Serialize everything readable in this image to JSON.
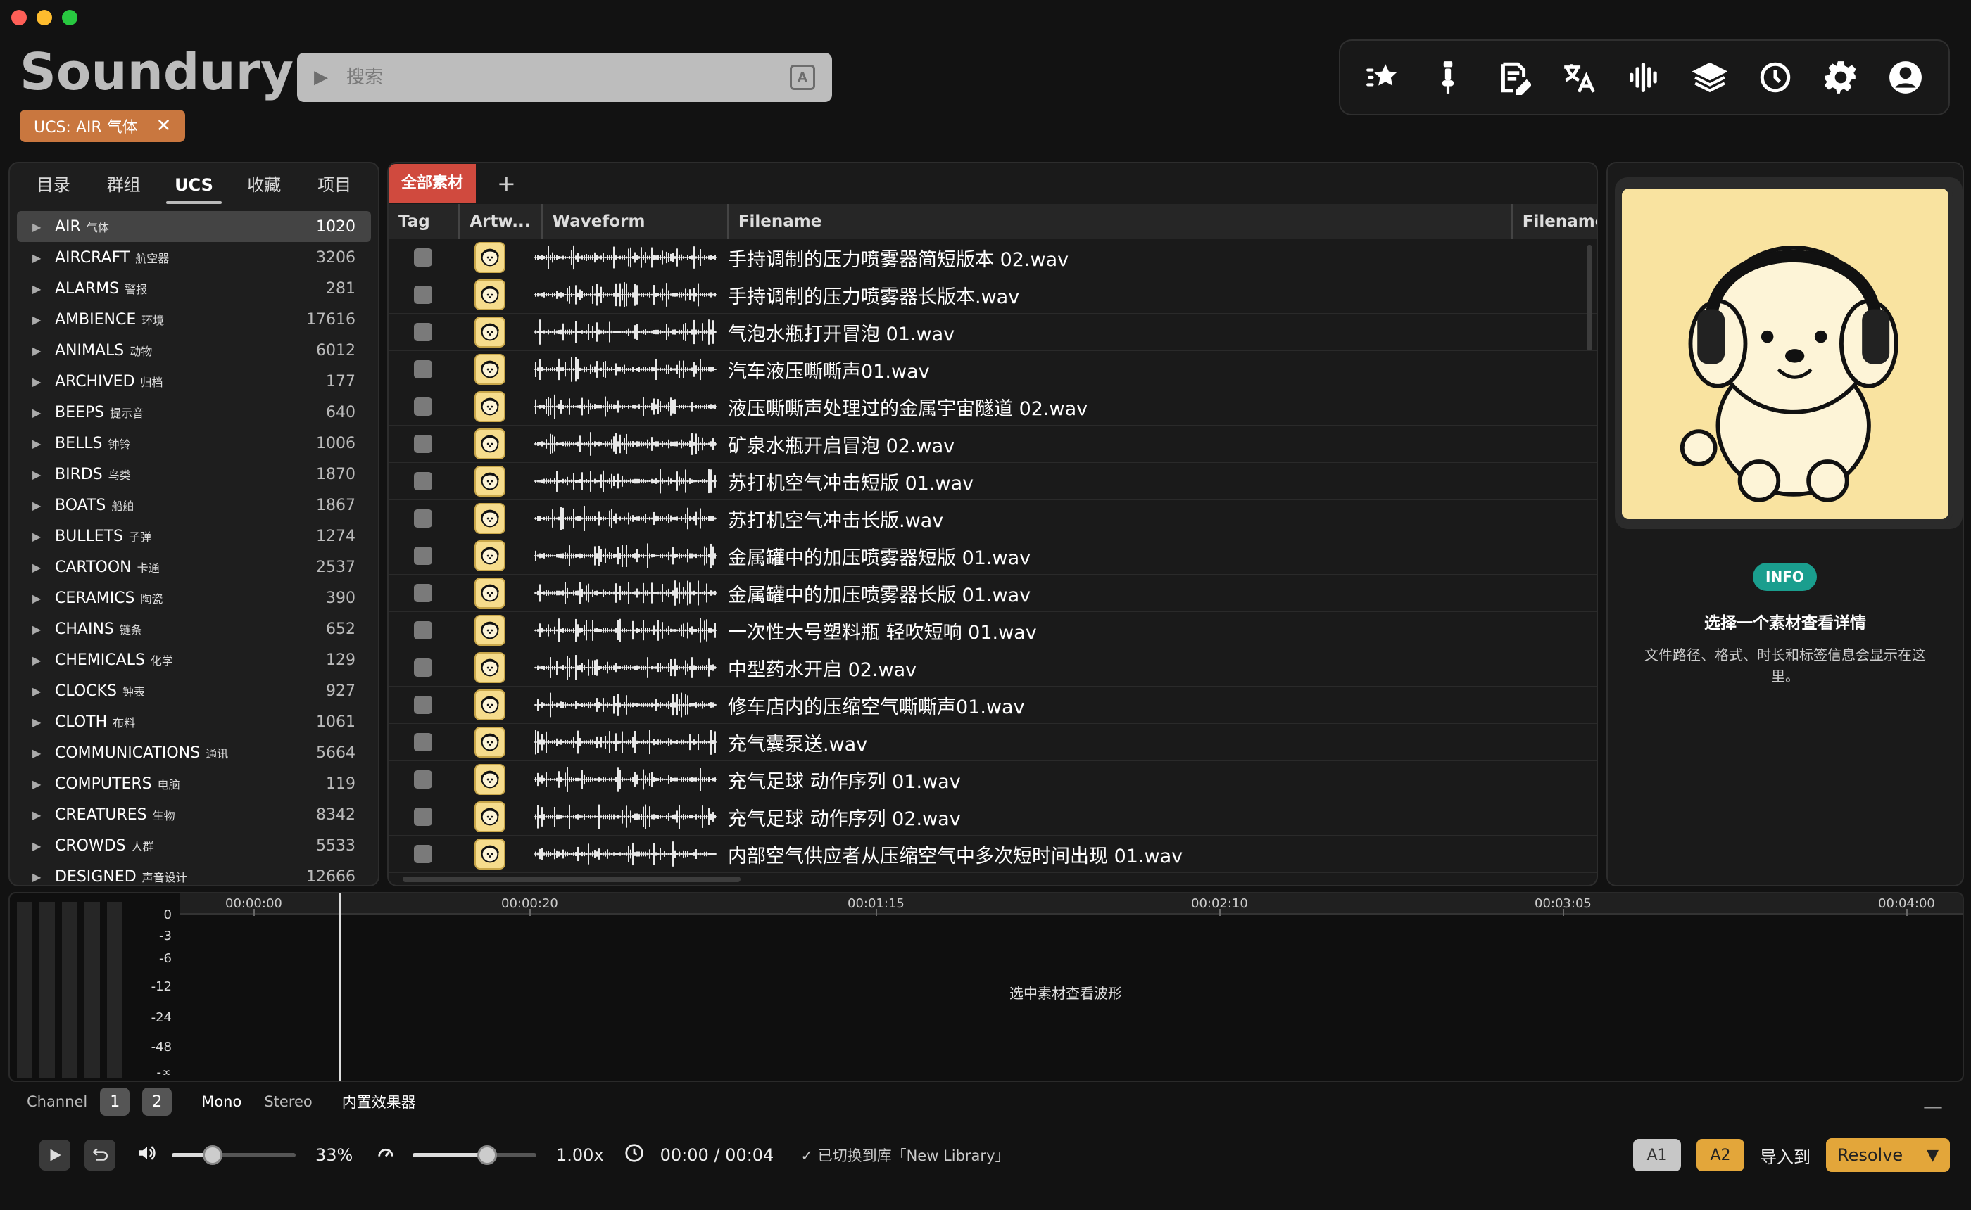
{
  "app": {
    "title": "Soundury",
    "search_placeholder": "搜索",
    "filter_chip": "UCS: AIR 气体"
  },
  "toolbar": {
    "icons": [
      "star-sparkle-icon",
      "microphone-icon",
      "edit-document-icon",
      "translate-icon",
      "waveform-icon",
      "layers-icon",
      "history-icon",
      "gear-icon",
      "user-icon"
    ]
  },
  "left_panel": {
    "tabs": [
      "目录",
      "群组",
      "UCS",
      "收藏",
      "项目"
    ],
    "active_tab": "UCS",
    "categories": [
      {
        "name": "AIR",
        "zh": "气体",
        "count": "1020"
      },
      {
        "name": "AIRCRAFT",
        "zh": "航空器",
        "count": "3206"
      },
      {
        "name": "ALARMS",
        "zh": "警报",
        "count": "281"
      },
      {
        "name": "AMBIENCE",
        "zh": "环境",
        "count": "17616"
      },
      {
        "name": "ANIMALS",
        "zh": "动物",
        "count": "6012"
      },
      {
        "name": "ARCHIVED",
        "zh": "归档",
        "count": "177"
      },
      {
        "name": "BEEPS",
        "zh": "提示音",
        "count": "640"
      },
      {
        "name": "BELLS",
        "zh": "钟铃",
        "count": "1006"
      },
      {
        "name": "BIRDS",
        "zh": "鸟类",
        "count": "1870"
      },
      {
        "name": "BOATS",
        "zh": "船舶",
        "count": "1867"
      },
      {
        "name": "BULLETS",
        "zh": "子弹",
        "count": "1274"
      },
      {
        "name": "CARTOON",
        "zh": "卡通",
        "count": "2537"
      },
      {
        "name": "CERAMICS",
        "zh": "陶瓷",
        "count": "390"
      },
      {
        "name": "CHAINS",
        "zh": "链条",
        "count": "652"
      },
      {
        "name": "CHEMICALS",
        "zh": "化学",
        "count": "129"
      },
      {
        "name": "CLOCKS",
        "zh": "钟表",
        "count": "927"
      },
      {
        "name": "CLOTH",
        "zh": "布料",
        "count": "1061"
      },
      {
        "name": "COMMUNICATIONS",
        "zh": "通讯",
        "count": "5664"
      },
      {
        "name": "COMPUTERS",
        "zh": "电脑",
        "count": "119"
      },
      {
        "name": "CREATURES",
        "zh": "生物",
        "count": "8342"
      },
      {
        "name": "CROWDS",
        "zh": "人群",
        "count": "5533"
      },
      {
        "name": "DESIGNED",
        "zh": "声音设计",
        "count": "12666"
      }
    ]
  },
  "center_panel": {
    "tab_all": "全部素材",
    "tab_add": "+",
    "columns": [
      "Tag",
      "Artw...",
      "Waveform",
      "Filename",
      "Filename"
    ],
    "files": [
      "手持调制的压力喷雾器简短版本 02.wav",
      "手持调制的压力喷雾器长版本.wav",
      "气泡水瓶打开冒泡 01.wav",
      "汽车液压嘶嘶声01.wav",
      "液压嘶嘶声处理过的金属宇宙隧道 02.wav",
      "矿泉水瓶开启冒泡 02.wav",
      "苏打机空气冲击短版 01.wav",
      "苏打机空气冲击长版.wav",
      "金属罐中的加压喷雾器短版 01.wav",
      "金属罐中的加压喷雾器长版 01.wav",
      "一次性大号塑料瓶 轻吹短响 01.wav",
      "中型药水开启 02.wav",
      "修车店内的压缩空气嘶嘶声01.wav",
      "充气囊泵送.wav",
      "充气足球 动作序列 01.wav",
      "充气足球 动作序列 02.wav",
      "内部空气供应者从压缩空气中多次短时间出现 01.wav"
    ]
  },
  "right_panel": {
    "badge": "INFO",
    "title": "选择一个素材查看详情",
    "description": "文件路径、格式、时长和标签信息会显示在这里。"
  },
  "waveform_panel": {
    "db_scale": [
      "0",
      "-3",
      "-6",
      "-12",
      "-24",
      "-48",
      "-∞"
    ],
    "timeline": [
      "00:00:00",
      "00:00:20",
      "00:01:15",
      "00:02:10",
      "00:03:05",
      "00:04:00"
    ],
    "empty_message": "选中素材查看波形"
  },
  "channel": {
    "label": "Channel",
    "buttons": [
      "1",
      "2"
    ],
    "mono": "Mono",
    "stereo": "Stereo",
    "effects": "内置效果器",
    "minimize": "—"
  },
  "transport": {
    "volume": "33%",
    "volume_level": 0.33,
    "speed": "1.00x",
    "speed_level": 0.6,
    "time": "00:00 / 00:04",
    "status": "✓ 已切换到库「New Library」",
    "a1": "A1",
    "a2": "A2",
    "import_label": "导入到",
    "target": "Resolve"
  }
}
